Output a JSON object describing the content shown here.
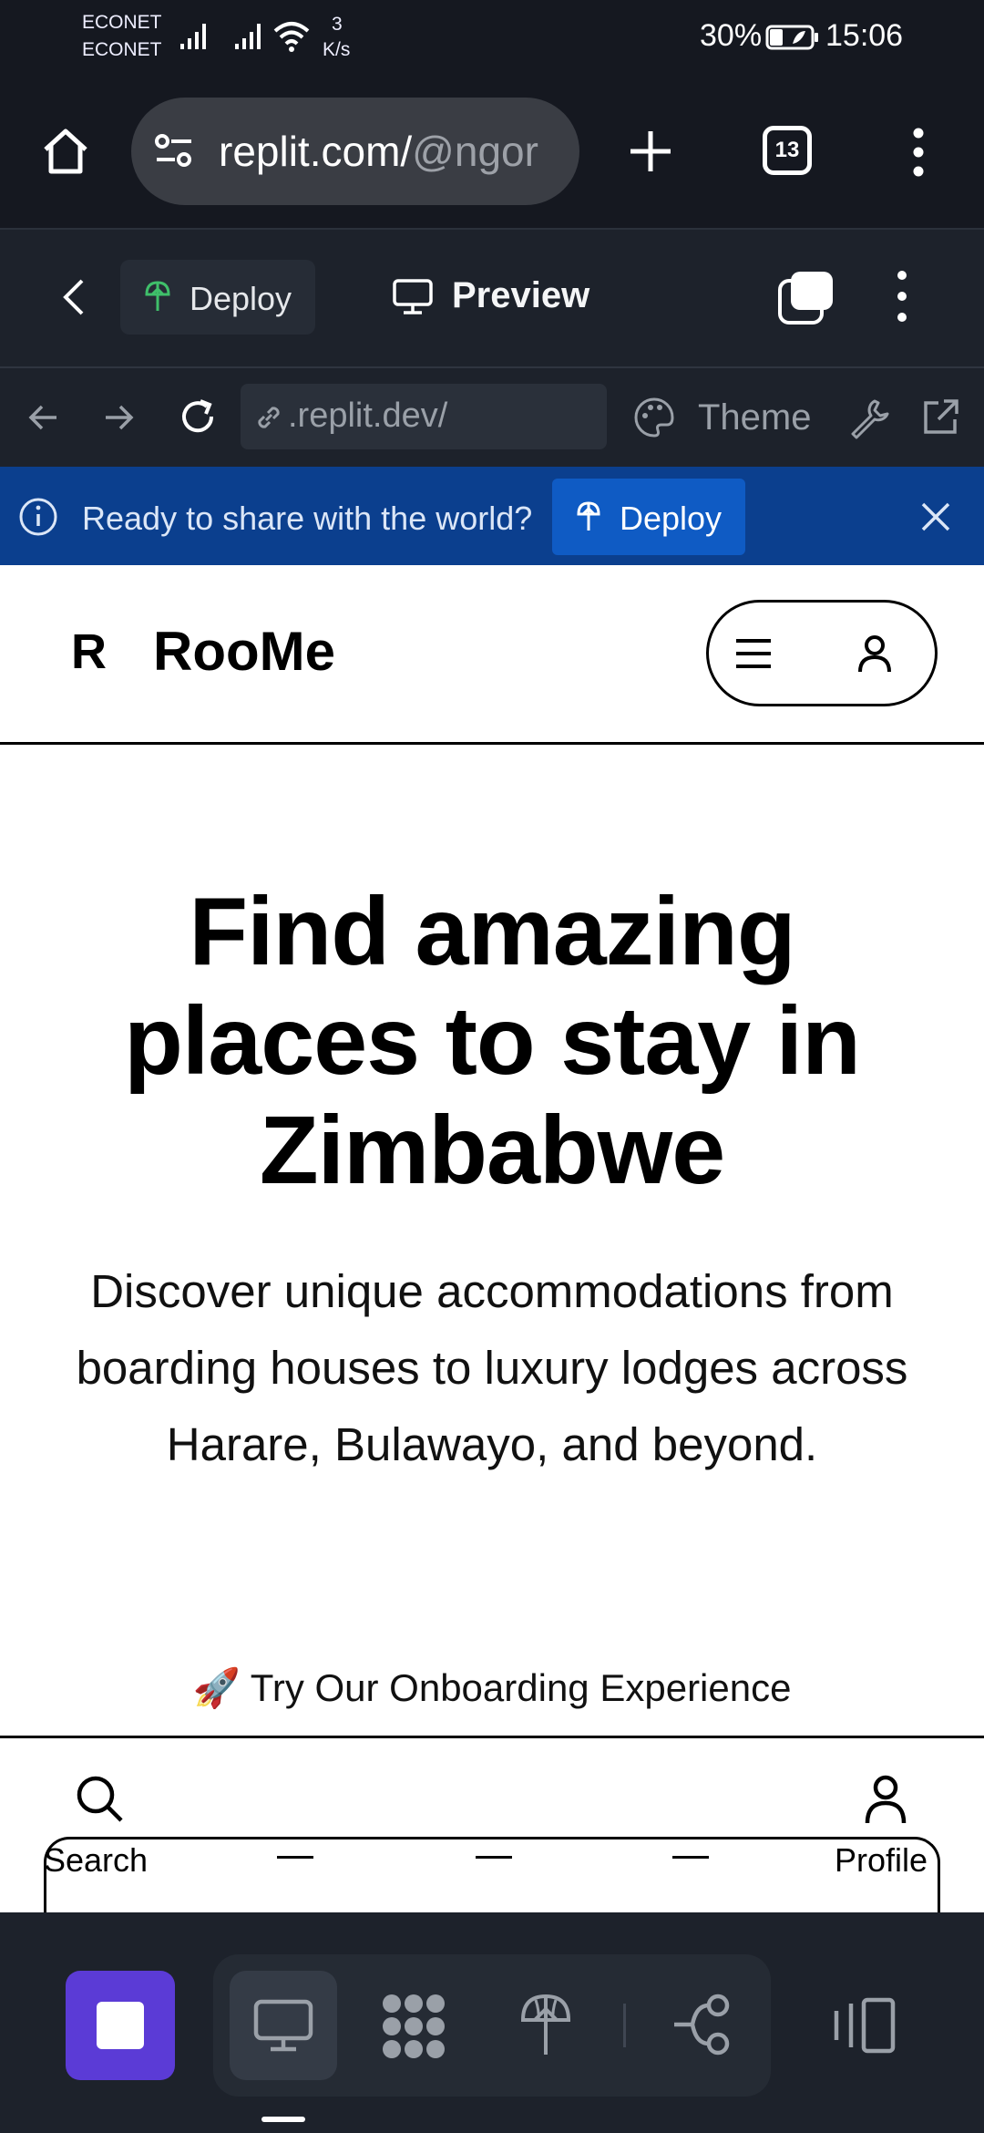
{
  "status_bar": {
    "carrier_1": "ECONET",
    "carrier_2": "ECONET",
    "speed_value": "3",
    "speed_unit": "K/s",
    "battery": "30%",
    "time": "15:06"
  },
  "browser": {
    "url_host": "replit.com/",
    "url_path": "@ngor",
    "tab_count": "13"
  },
  "replit_header": {
    "deploy_label": "Deploy",
    "preview_label": "Preview"
  },
  "webview_toolbar": {
    "address": ".replit.dev/",
    "theme_label": "Theme"
  },
  "banner": {
    "message": "Ready to share with the world?",
    "button_label": "Deploy"
  },
  "app": {
    "logo_letter": "R",
    "title": "RooMe",
    "hero_title": "Find amazing places to stay in Zimbabwe",
    "hero_subtitle": "Discover unique accommodations from boarding houses to luxury lodges across Harare, Bulawayo, and beyond.",
    "onboarding_link": "🚀 Try Our Onboarding Experience"
  },
  "bottom_nav": {
    "search_label": "Search",
    "profile_label": "Profile"
  },
  "colors": {
    "accent_purple": "#5b3bd6",
    "banner_blue": "#0b3f8e",
    "deploy_green": "#3fbf6a",
    "dark_bg": "#1d222b"
  }
}
